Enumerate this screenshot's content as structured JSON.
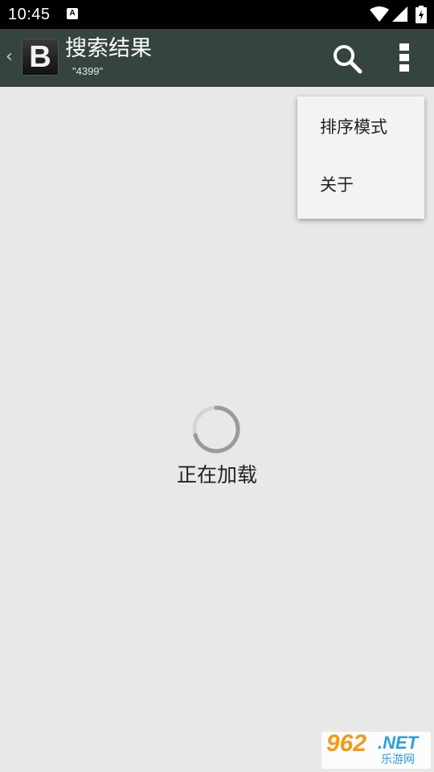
{
  "status_bar": {
    "time": "10:45",
    "notification_icon": "A"
  },
  "action_bar": {
    "back_icon": "‹",
    "logo_letter": "B",
    "title": "搜索结果",
    "subtitle": "\"4399\"",
    "search_icon": "search-icon",
    "overflow_icon": "overflow-menu-icon",
    "background_color": "#354440"
  },
  "menu": {
    "items": [
      {
        "label": "排序模式"
      },
      {
        "label": "关于"
      }
    ]
  },
  "loading": {
    "text": "正在加载"
  },
  "watermark": {
    "big": "962",
    "net": ".NET",
    "sub": "乐游网"
  }
}
